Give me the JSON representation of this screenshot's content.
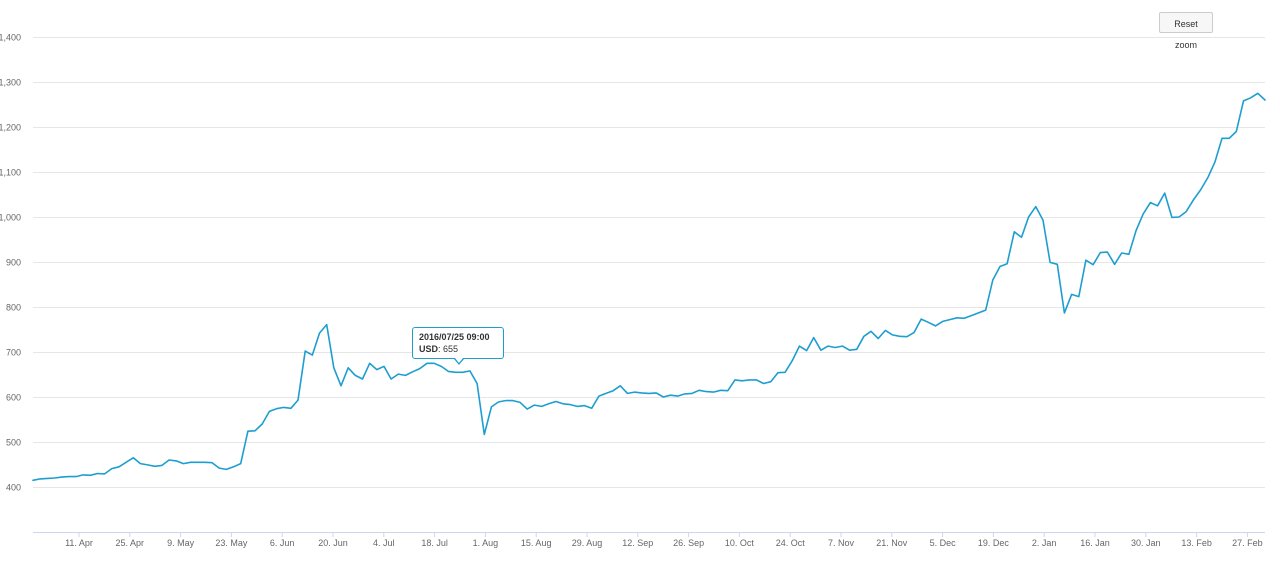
{
  "reset_zoom_label": "Reset zoom",
  "chart_data": {
    "type": "line",
    "title": "",
    "xlabel": "",
    "ylabel": "",
    "ylim": [
      300,
      1400
    ],
    "grid": true,
    "line_color": "#1e9ed0",
    "y_ticks": [
      400,
      500,
      600,
      700,
      800,
      900,
      1000,
      1100,
      1200,
      1300,
      1400
    ],
    "y_tick_labels": [
      "400",
      "500",
      "600",
      "700",
      "800",
      "900",
      "1,000",
      "1,100",
      "1,200",
      "1,300",
      "1,400"
    ],
    "x_tick_labels": [
      "11. Apr",
      "25. Apr",
      "9. May",
      "23. May",
      "6. Jun",
      "20. Jun",
      "4. Jul",
      "18. Jul",
      "1. Aug",
      "15. Aug",
      "29. Aug",
      "12. Sep",
      "26. Sep",
      "10. Oct",
      "24. Oct",
      "7. Nov",
      "21. Nov",
      "5. Dec",
      "19. Dec",
      "2. Jan",
      "16. Jan",
      "30. Jan",
      "13. Feb",
      "27. Feb"
    ],
    "series": [
      {
        "values": [
          415,
          418,
          419,
          420,
          422,
          423,
          423,
          427,
          426,
          430,
          429,
          441,
          445,
          455,
          465,
          452,
          449,
          446,
          448,
          460,
          458,
          452,
          455,
          455,
          455,
          454,
          442,
          439,
          445,
          452,
          524,
          525,
          540,
          568,
          574,
          577,
          575,
          593,
          702,
          693,
          742,
          761,
          665,
          625,
          665,
          648,
          640,
          675,
          661,
          668,
          640,
          651,
          648,
          656,
          663,
          675,
          675,
          668,
          657,
          655,
          655,
          658,
          630,
          517,
          578,
          589,
          592,
          592,
          588,
          573,
          582,
          579,
          585,
          590,
          585,
          583,
          579,
          581,
          575,
          602,
          608,
          614,
          625,
          608,
          611,
          609,
          608,
          609,
          600,
          604,
          602,
          607,
          608,
          615,
          612,
          611,
          615,
          614,
          638,
          636,
          638,
          638,
          630,
          634,
          654,
          655,
          681,
          713,
          703,
          732,
          704,
          713,
          710,
          713,
          704,
          706,
          735,
          746,
          730,
          748,
          738,
          735,
          734,
          743,
          773,
          766,
          758,
          768,
          772,
          776,
          775,
          781,
          787,
          793,
          860,
          890,
          896,
          967,
          955,
          1000,
          1023,
          993,
          899,
          895,
          787,
          828,
          823,
          904,
          894,
          921,
          922,
          895,
          920,
          917,
          970,
          1007,
          1032,
          1025,
          1053,
          999,
          1000,
          1012,
          1038,
          1060,
          1087,
          1122,
          1175,
          1175,
          1190,
          1258,
          1265,
          1275,
          1260
        ]
      }
    ],
    "tooltip": {
      "date": "2016/07/25 09:00",
      "series": "USD",
      "value": "655"
    }
  }
}
